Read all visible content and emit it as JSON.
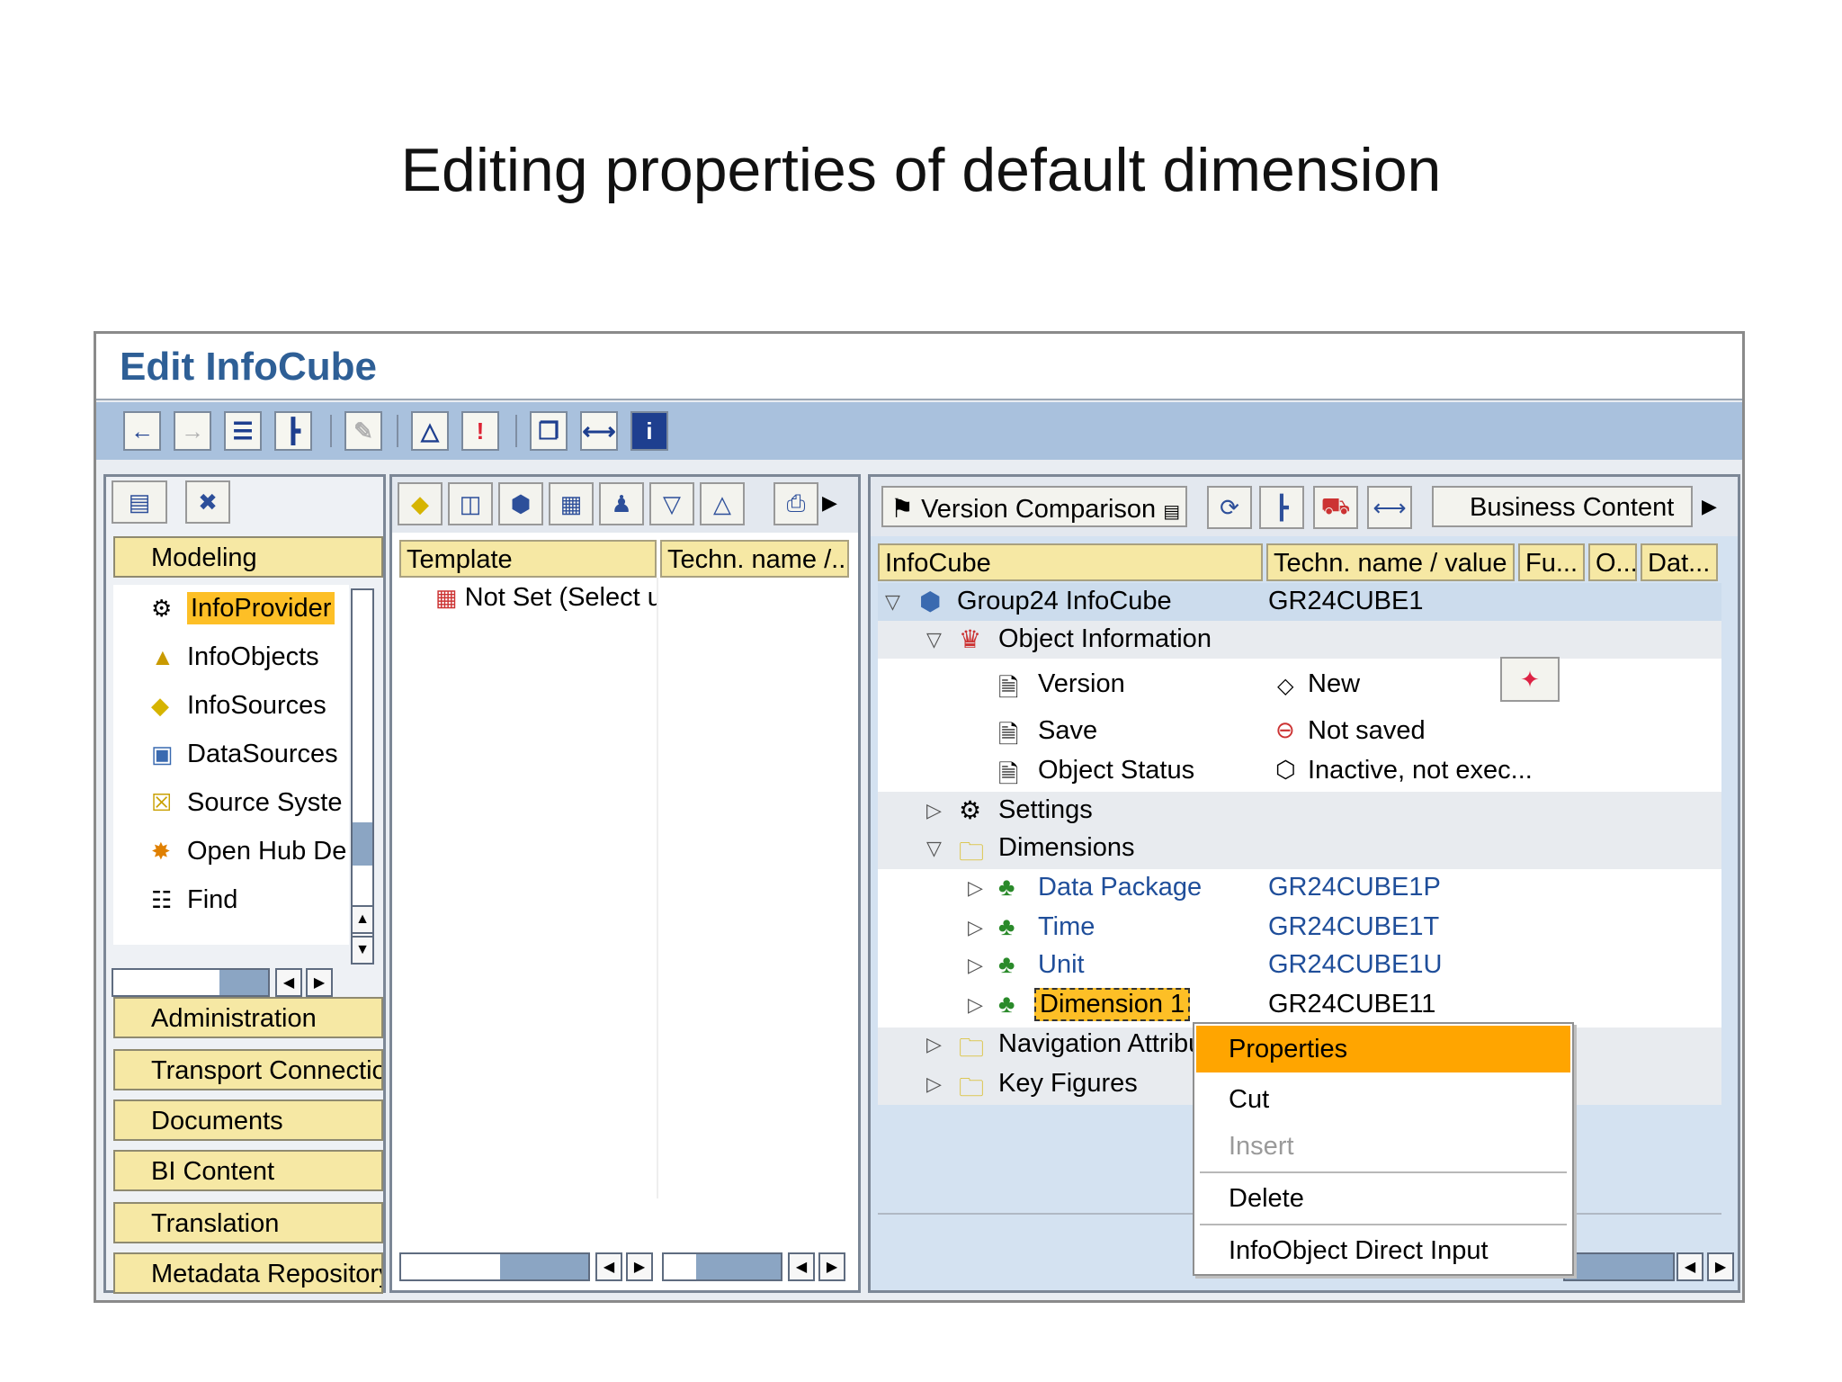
{
  "slide": {
    "title": "Editing properties of default dimension"
  },
  "window": {
    "title": "Edit InfoCube"
  },
  "toolbar": {
    "buttons": [
      "back-icon",
      "forward-icon",
      "list-icon",
      "tree-icon",
      "pencil-icon",
      "hierarchy-icon",
      "exclamation-icon",
      "copy-icon",
      "connect-icon",
      "info-icon"
    ]
  },
  "nav": {
    "modeling_label": "Modeling",
    "items": [
      {
        "label": "InfoProvider",
        "icon": "infoprovider-icon"
      },
      {
        "label": "InfoObjects",
        "icon": "infoobjects-icon"
      },
      {
        "label": "InfoSources",
        "icon": "infosources-icon"
      },
      {
        "label": "DataSources",
        "icon": "datasources-icon"
      },
      {
        "label": "Source Syste",
        "icon": "source-system-icon"
      },
      {
        "label": "Open Hub De",
        "icon": "open-hub-icon"
      },
      {
        "label": "Find",
        "icon": "find-icon"
      }
    ],
    "sections": [
      "Administration",
      "Transport Connectio",
      "Documents",
      "BI Content",
      "Translation",
      "Metadata Repository"
    ]
  },
  "template_panel": {
    "col_template": "Template",
    "col_techn": "Techn. name /...",
    "row_label": "Not Set (Select u"
  },
  "infocube_panel": {
    "version_comparison": "Version Comparison",
    "business_content": "Business Content",
    "headers": {
      "infocube": "InfoCube",
      "techn": "Techn. name / value",
      "fu": "Fu...",
      "o": "O...",
      "dat": "Dat..."
    },
    "tree": {
      "group": {
        "label": "Group24 InfoCube",
        "value": "GR24CUBE1"
      },
      "object_info": "Object Information",
      "version": {
        "label": "Version",
        "value": "New"
      },
      "save": {
        "label": "Save",
        "value": "Not saved"
      },
      "object_status": {
        "label": "Object Status",
        "value": "Inactive, not exec..."
      },
      "settings": "Settings",
      "dimensions": "Dimensions",
      "dims": [
        {
          "label": "Data Package",
          "value": "GR24CUBE1P"
        },
        {
          "label": "Time",
          "value": "GR24CUBE1T"
        },
        {
          "label": "Unit",
          "value": "GR24CUBE1U"
        },
        {
          "label": "Dimension 1",
          "value": "GR24CUBE11"
        }
      ],
      "nav_attr": "Navigation Attribu",
      "key_figures": "Key Figures"
    }
  },
  "context_menu": {
    "properties": "Properties",
    "cut": "Cut",
    "insert": "Insert",
    "delete": "Delete",
    "direct_input": "InfoObject Direct Input"
  },
  "colors": {
    "accent": "#fdbf26",
    "menu_highlight": "#ffa500",
    "title_blue": "#2e5f96",
    "toolbar": "#a9c1dd"
  }
}
